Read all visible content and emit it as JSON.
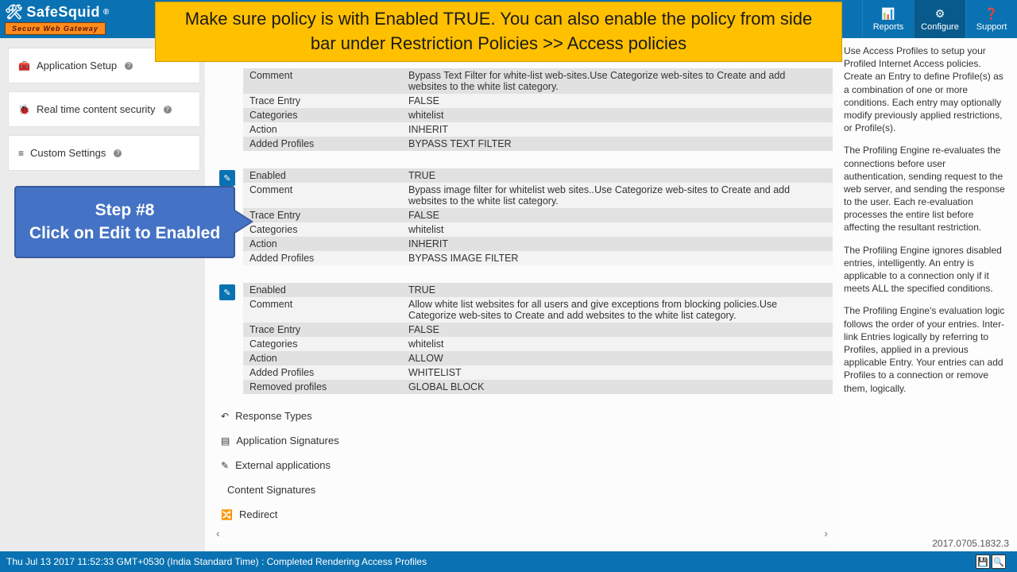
{
  "header": {
    "logo_main": "SafeSquid",
    "logo_reg": "®",
    "logo_sub": "Secure Web Gateway",
    "nav": [
      {
        "icon": "📊",
        "label": "Reports"
      },
      {
        "icon": "⚙",
        "label": "Configure"
      },
      {
        "icon": "❓",
        "label": "Support"
      }
    ]
  },
  "banner": "Make sure policy is with Enabled TRUE. You can also enable the policy from side bar under Restriction Policies >> Access policies",
  "callout": {
    "line1": "Step #8",
    "line2": "Click on Edit to Enabled"
  },
  "sidebar": {
    "items": [
      {
        "icon": "🧰",
        "label": "Application Setup"
      },
      {
        "icon": "🐞",
        "label": "Real time content security"
      },
      {
        "icon": "≡",
        "label": "Custom Settings"
      }
    ]
  },
  "policies": [
    {
      "rows": [
        {
          "k": "Comment",
          "v": "Bypass Text Filter for white-list web-sites.Use Categorize web-sites to Create and add websites to the white list category."
        },
        {
          "k": "Trace Entry",
          "v": "FALSE"
        },
        {
          "k": "Categories",
          "v": "whitelist"
        },
        {
          "k": "Action",
          "v": "INHERIT"
        },
        {
          "k": "Added Profiles",
          "v": "BYPASS TEXT FILTER"
        }
      ]
    },
    {
      "rows": [
        {
          "k": "Enabled",
          "v": "TRUE"
        },
        {
          "k": "Comment",
          "v": "Bypass image filter for whitelist web sites..Use Categorize web-sites to Create and add websites to the white list category."
        },
        {
          "k": "Trace Entry",
          "v": "FALSE"
        },
        {
          "k": "Categories",
          "v": "whitelist"
        },
        {
          "k": "Action",
          "v": "INHERIT"
        },
        {
          "k": "Added Profiles",
          "v": "BYPASS IMAGE FILTER"
        }
      ]
    },
    {
      "rows": [
        {
          "k": "Enabled",
          "v": "TRUE"
        },
        {
          "k": "Comment",
          "v": "Allow white list websites for all users and give exceptions from blocking policies.Use Categorize web-sites to Create and add websites to the white list category."
        },
        {
          "k": "Trace Entry",
          "v": "FALSE"
        },
        {
          "k": "Categories",
          "v": "whitelist"
        },
        {
          "k": "Action",
          "v": "ALLOW"
        },
        {
          "k": "Added Profiles",
          "v": "WHITELIST"
        },
        {
          "k": "Removed profiles",
          "v": "GLOBAL BLOCK"
        }
      ]
    }
  ],
  "accordions": [
    {
      "icon": "↶",
      "label": "Response Types"
    },
    {
      "icon": "▤",
      "label": "Application Signatures"
    },
    {
      "icon": "✎",
      "label": "External applications"
    },
    {
      "icon": "",
      "label": "Content Signatures"
    },
    {
      "icon": "🔀",
      "label": "Redirect"
    }
  ],
  "help": {
    "p1": "Use Access Profiles to setup your Profiled Internet Access policies. Create an Entry to define Profile(s) as a combination of one or more conditions. Each entry may optionally modify previously applied restrictions, or Profile(s).",
    "p2": "The Profiling Engine re-evaluates the connections before user authentication, sending request to the web server, and sending the response to the user. Each re-evaluation processes the entire list before affecting the resultant restriction.",
    "p3": "The Profiling Engine ignores disabled entries, intelligently. An entry is applicable to a connection only if it meets ALL the specified conditions.",
    "p4": "The Profiling Engine's evaluation logic follows the order of your entries. Inter-link Entries logically by referring to Profiles, applied in a previous applicable Entry. Your entries can add Profiles to a connection or remove them, logically."
  },
  "footer": {
    "status": "Thu Jul 13 2017 11:52:33 GMT+0530 (India Standard Time) : Completed Rendering Access Profiles",
    "version": "2017.0705.1832.3"
  }
}
